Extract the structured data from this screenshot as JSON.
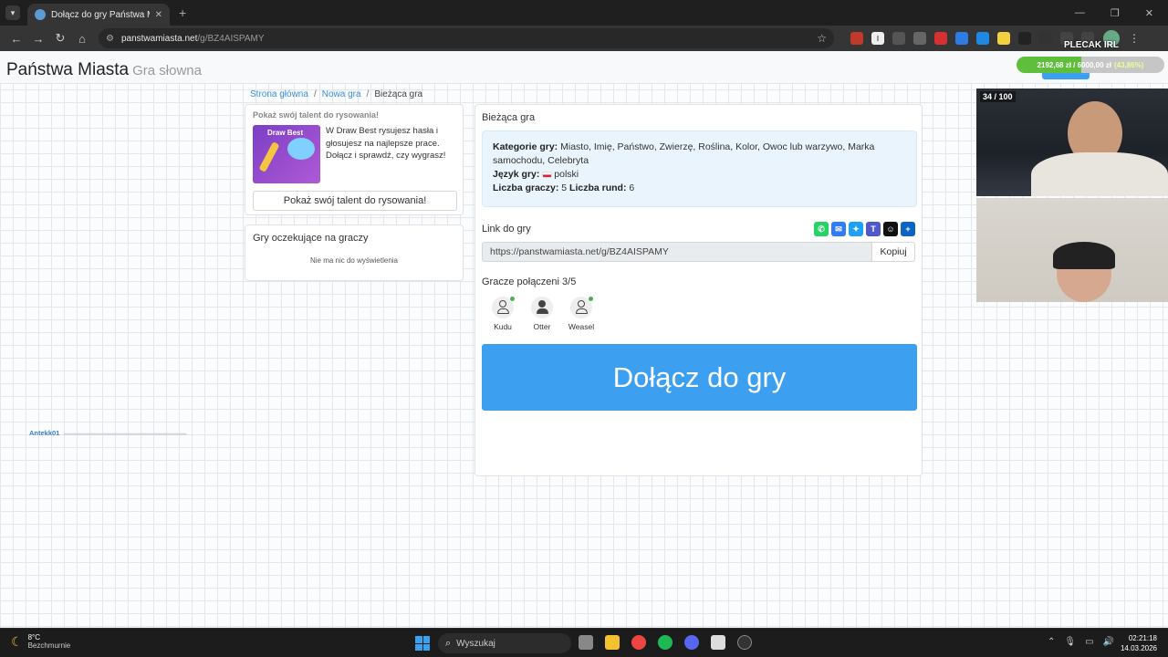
{
  "browser": {
    "tab_title": "Dołącz do gry Państwa Miasta",
    "url_host": "panstwamiasta.net",
    "url_path": "/g/BZ4AISPAMY",
    "overlay_title": "PLECAK IRL"
  },
  "header": {
    "brand": "Państwa Miasta",
    "brand_sub": "Gra słowna",
    "donation_amount": "2192,68 zł",
    "donation_goal": "6000,00 zł",
    "donation_percent": "(43,86%)",
    "donation_progress": 0.4386
  },
  "breadcrumb": {
    "home": "Strona główna",
    "new_game": "Nowa gra",
    "current": "Bieżąca gra"
  },
  "promo": {
    "heading": "Pokaż swój talent do rysowania!",
    "image_title": "Draw Best",
    "text": "W Draw Best rysujesz hasła i głosujesz na najlepsze prace. Dołącz i sprawdź, czy wygrasz!",
    "button": "Pokaż swój talent do rysowania!"
  },
  "waiting": {
    "title": "Gry oczekujące na graczy",
    "empty": "Nie ma nic do wyświetlenia"
  },
  "game": {
    "title": "Bieżąca gra",
    "categories_label": "Kategorie gry:",
    "categories": "Miasto, Imię, Państwo, Zwierzę, Roślina, Kolor, Owoc lub warzywo, Marka samochodu, Celebryta",
    "language_label": "Język gry:",
    "language": "polski",
    "players_label": "Liczba graczy:",
    "players_count": "5",
    "rounds_label": "Liczba rund:",
    "rounds_count": "6",
    "link_label": "Link do gry",
    "link_value": "https://panstwamiasta.net/g/BZ4AISPAMY",
    "copy": "Kopiuj",
    "connected_label": "Gracze połączeni 3/5",
    "players": [
      "Kudu",
      "Otter",
      "Weasel"
    ],
    "join": "Dołącz do gry"
  },
  "chat": {
    "user": "Antekk01"
  },
  "stream": {
    "counter": "34 / 100"
  },
  "taskbar": {
    "temp": "8°C",
    "weather": "Bezchmurnie",
    "search": "Wyszukaj",
    "time": "02:21:18",
    "date": "14.03.2026"
  },
  "colors": {
    "accent": "#3d9ff0",
    "link": "#3a8fd8",
    "info_bg": "#eaf4fc",
    "online": "#4caf50"
  }
}
